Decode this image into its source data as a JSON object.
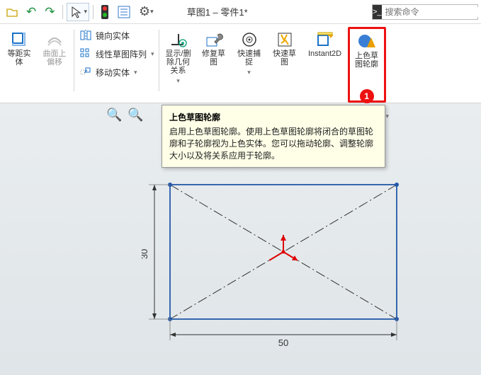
{
  "topbar": {
    "title": "草图1 – 零件1*",
    "search_placeholder": "搜索命令"
  },
  "ribbon": {
    "offset": {
      "label": "等距实\n体"
    },
    "surface_offset": {
      "label": "曲面上\n偏移"
    },
    "mirror": {
      "label": "镜向实体"
    },
    "linear_pattern": {
      "label": "线性草图阵列"
    },
    "move": {
      "label": "移动实体"
    },
    "display_delete": {
      "label": "显示/删\n除几何\n关系"
    },
    "repair": {
      "label": "修复草\n图"
    },
    "quick_snap": {
      "label": "快速捕\n捉"
    },
    "rapid_sketch": {
      "label": "快速草\n图"
    },
    "instant2d": {
      "label": "Instant2D"
    },
    "shaded_profile": {
      "label": "上色草\n图轮廓"
    }
  },
  "badge": {
    "num": "1"
  },
  "tooltip": {
    "title": "上色草图轮廓",
    "body": "启用上色草图轮廓。使用上色草图轮廓将闭合的草图轮廓和子轮廓视为上色实体。您可以拖动轮廓、调整轮廓大小以及将关系应用于轮廓。"
  },
  "chart_data": {
    "type": "diagram",
    "shape": "rectangle",
    "width": 50,
    "height": 30,
    "diagonals": true,
    "dim_width_label": "50",
    "dim_height_label": "30"
  }
}
